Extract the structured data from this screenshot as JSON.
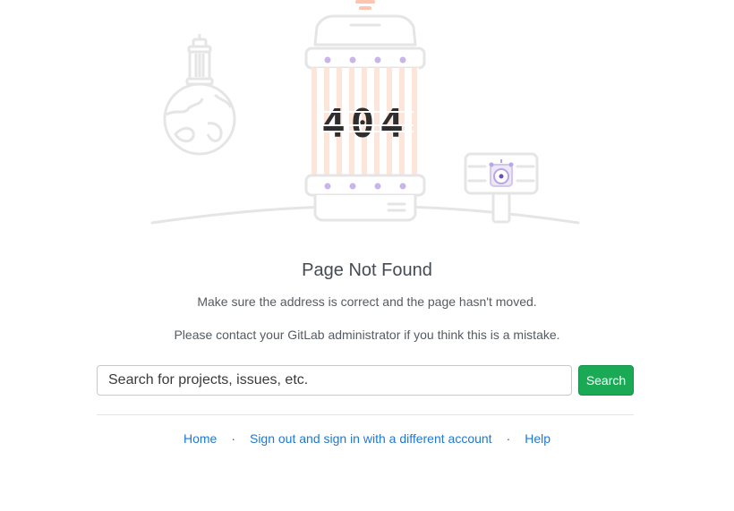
{
  "illustration": {
    "code_text": "404"
  },
  "page": {
    "title": "Page Not Found",
    "message_1": "Make sure the address is correct and the page hasn't moved.",
    "message_2": "Please contact your GitLab administrator if you think this is a mistake."
  },
  "search": {
    "placeholder": "Search for projects, issues, etc.",
    "button_label": "Search"
  },
  "footer": {
    "links": [
      {
        "label": "Home"
      },
      {
        "label": "Sign out and sign in with a different account"
      },
      {
        "label": "Help"
      }
    ],
    "separator": "·"
  },
  "colors": {
    "primary_button": "#1aaa55",
    "link": "#1f78d1",
    "illustration_accent": "#fc6d26",
    "illustration_purple": "#6b4fbb"
  }
}
